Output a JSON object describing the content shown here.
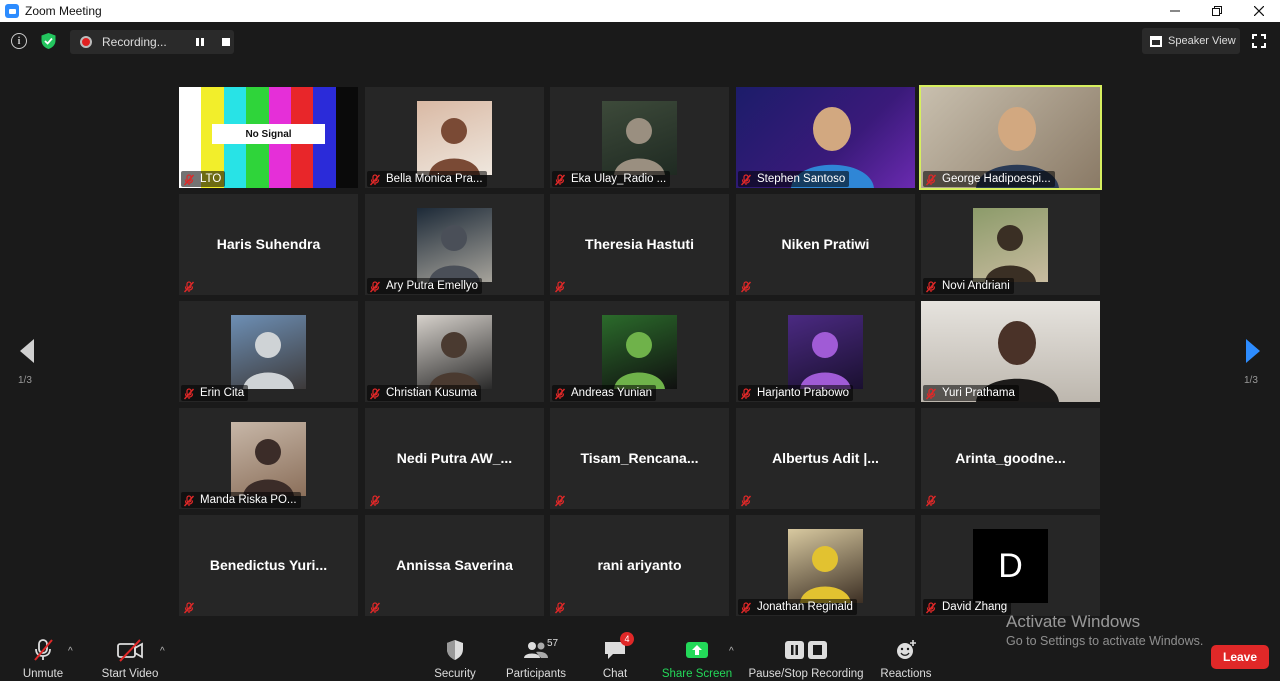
{
  "window": {
    "title": "Zoom Meeting"
  },
  "topbar": {
    "recording_label": "Recording...",
    "speaker_view_label": "Speaker View"
  },
  "pagination": {
    "left": "1/3",
    "right": "1/3"
  },
  "participants": [
    {
      "name": "LTO",
      "type": "nosignal",
      "no_signal_text": "No Signal"
    },
    {
      "name": "Bella Monica Pra...",
      "type": "photo"
    },
    {
      "name": "Eka Ulay_Radio ...",
      "type": "photo"
    },
    {
      "name": "Stephen Santoso",
      "type": "video"
    },
    {
      "name": "George Hadipoespi...",
      "type": "video",
      "active": true
    },
    {
      "name": "Haris Suhendra",
      "type": "name"
    },
    {
      "name": "Ary Putra Emellyo",
      "type": "photo"
    },
    {
      "name": "Theresia Hastuti",
      "type": "name"
    },
    {
      "name": "Niken Pratiwi",
      "type": "name"
    },
    {
      "name": "Novi Andriani",
      "type": "photo"
    },
    {
      "name": "Erin Cita",
      "type": "photo"
    },
    {
      "name": "Christian Kusuma",
      "type": "photo"
    },
    {
      "name": "Andreas Yunian",
      "type": "photo"
    },
    {
      "name": "Harjanto Prabowo",
      "type": "photo"
    },
    {
      "name": "Yuri Prathama",
      "type": "video"
    },
    {
      "name": "Manda Riska PO...",
      "type": "photo"
    },
    {
      "name": "Nedi Putra AW_...",
      "type": "name"
    },
    {
      "name": "Tisam_Rencana...",
      "type": "name"
    },
    {
      "name": "Albertus Adit |...",
      "type": "name"
    },
    {
      "name": "Arinta_goodne...",
      "type": "name"
    },
    {
      "name": "Benedictus  Yuri...",
      "type": "name"
    },
    {
      "name": "Annissa Saverina",
      "type": "name"
    },
    {
      "name": "rani ariyanto",
      "type": "name"
    },
    {
      "name": "Jonathan Reginald",
      "type": "photo"
    },
    {
      "name": "David Zhang",
      "type": "initial",
      "initial": "D"
    }
  ],
  "toolbar": {
    "unmute": "Unmute",
    "start_video": "Start Video",
    "security": "Security",
    "participants": "Participants",
    "participants_count": "57",
    "chat": "Chat",
    "chat_badge": "4",
    "share_screen": "Share Screen",
    "pause_stop_recording": "Pause/Stop Recording",
    "reactions": "Reactions",
    "leave": "Leave"
  },
  "watermark": {
    "title": "Activate Windows",
    "subtitle": "Go to Settings to activate Windows."
  },
  "colors": {
    "active_speaker": "#d7ef5f",
    "share_green": "#23d959",
    "leave_red": "#e02828",
    "mic_off_red": "#e02828"
  }
}
